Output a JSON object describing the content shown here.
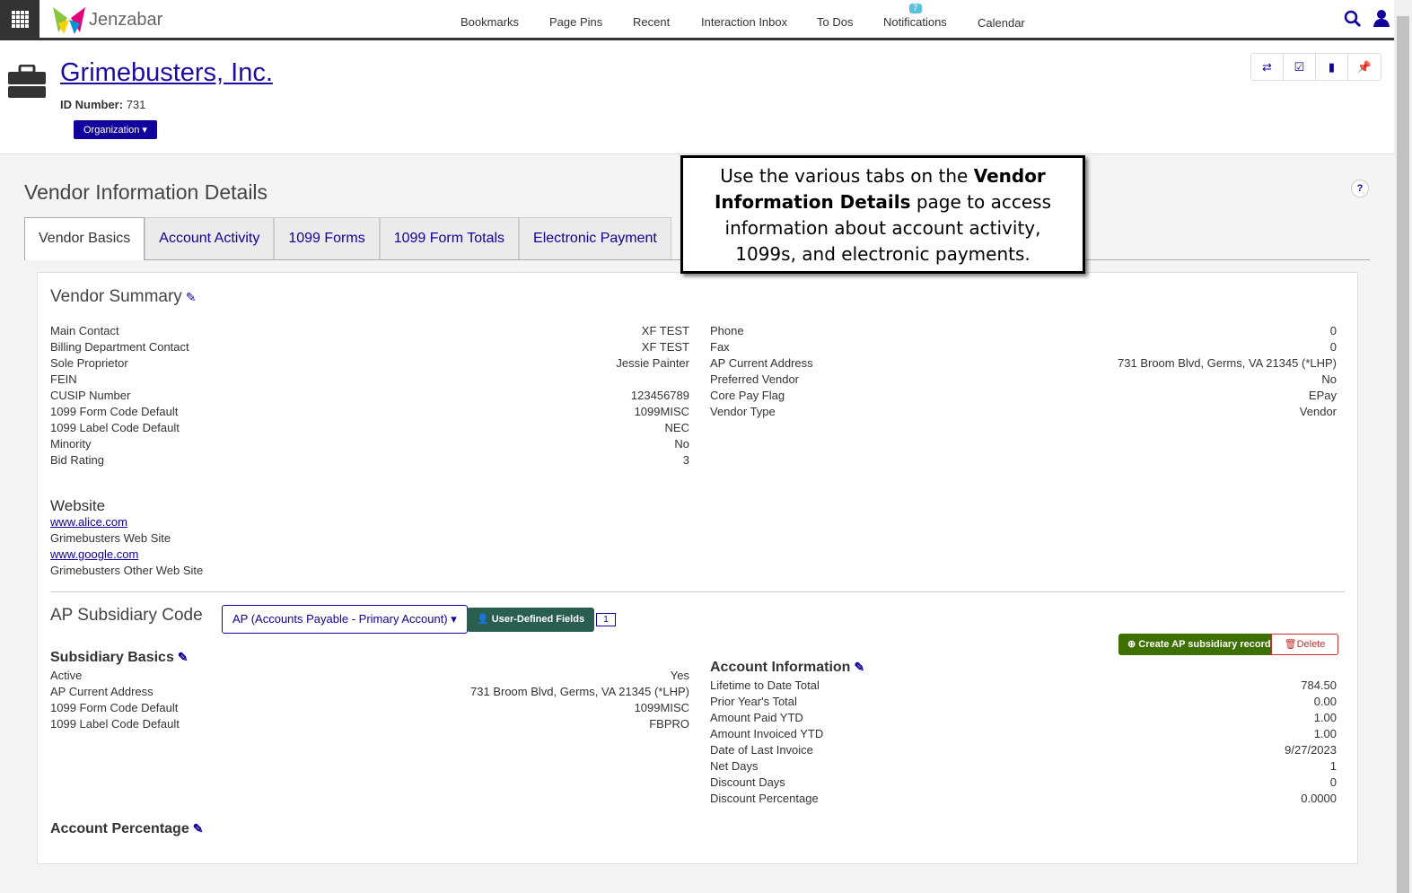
{
  "nav": {
    "brand": "Jenzabar",
    "links": [
      "Bookmarks",
      "Page Pins",
      "Recent",
      "Interaction Inbox",
      "To Dos",
      "Notifications",
      "Calendar"
    ],
    "notifications_count": "7"
  },
  "header": {
    "title": "Grimebusters, Inc.",
    "id_label": "ID Number:",
    "id_value": "731",
    "org_button": "Organization"
  },
  "page": {
    "title": "Vendor Information Details",
    "help": "?"
  },
  "tabs": [
    "Vendor Basics",
    "Account Activity",
    "1099 Forms",
    "1099 Form Totals",
    "Electronic Payment"
  ],
  "callout": {
    "pre": "Use the various tabs on the ",
    "bold": "Vendor Information Details",
    "post": " page to access information about account activity, 1099s, and electronic payments."
  },
  "summary": {
    "title": "Vendor Summary",
    "left": [
      [
        "Main Contact",
        "XF TEST"
      ],
      [
        "Billing Department Contact",
        "XF TEST"
      ],
      [
        "Sole Proprietor",
        "Jessie Painter"
      ],
      [
        "FEIN",
        ""
      ],
      [
        "CUSIP Number",
        "123456789"
      ],
      [
        "1099 Form Code Default",
        "1099MISC"
      ],
      [
        "1099 Label Code Default",
        "NEC"
      ],
      [
        "Minority",
        "No"
      ],
      [
        "Bid Rating",
        "3"
      ]
    ],
    "right": [
      [
        "Phone",
        "0"
      ],
      [
        "Fax",
        "0"
      ],
      [
        "AP Current Address",
        "731 Broom Blvd, Germs, VA 21345 (*LHP)"
      ],
      [
        "Preferred Vendor",
        "No"
      ],
      [
        "Core Pay Flag",
        "EPay"
      ],
      [
        "Vendor Type",
        "Vendor"
      ]
    ]
  },
  "website": {
    "title": "Website",
    "items": [
      {
        "url": "www.alice.com",
        "desc": "Grimebusters Web Site"
      },
      {
        "url": "www.google.com",
        "desc": "Grimebusters Other Web Site"
      }
    ]
  },
  "ap": {
    "title": "AP Subsidiary Code",
    "select": "AP (Accounts Payable - Primary Account)",
    "udf": "User-Defined Fields",
    "comments": "1",
    "create": "Create AP subsidiary record",
    "delete": "Delete"
  },
  "basics": {
    "title": "Subsidiary Basics",
    "rows": [
      [
        "Active",
        "Yes"
      ],
      [
        "AP Current Address",
        "731 Broom Blvd, Germs, VA 21345 (*LHP)"
      ],
      [
        "1099 Form Code Default",
        "1099MISC"
      ],
      [
        "1099 Label Code Default",
        "FBPRO"
      ]
    ]
  },
  "account": {
    "title": "Account Information",
    "rows": [
      [
        "Lifetime to Date Total",
        "784.50"
      ],
      [
        "Prior Year's Total",
        "0.00"
      ],
      [
        "Amount Paid YTD",
        "1.00"
      ],
      [
        "Amount Invoiced YTD",
        "1.00"
      ],
      [
        "Date of Last Invoice",
        "9/27/2023"
      ],
      [
        "Net Days",
        "1"
      ],
      [
        "Discount Days",
        "0"
      ],
      [
        "Discount Percentage",
        "0.0000"
      ]
    ]
  },
  "percentage": {
    "title": "Account Percentage"
  }
}
